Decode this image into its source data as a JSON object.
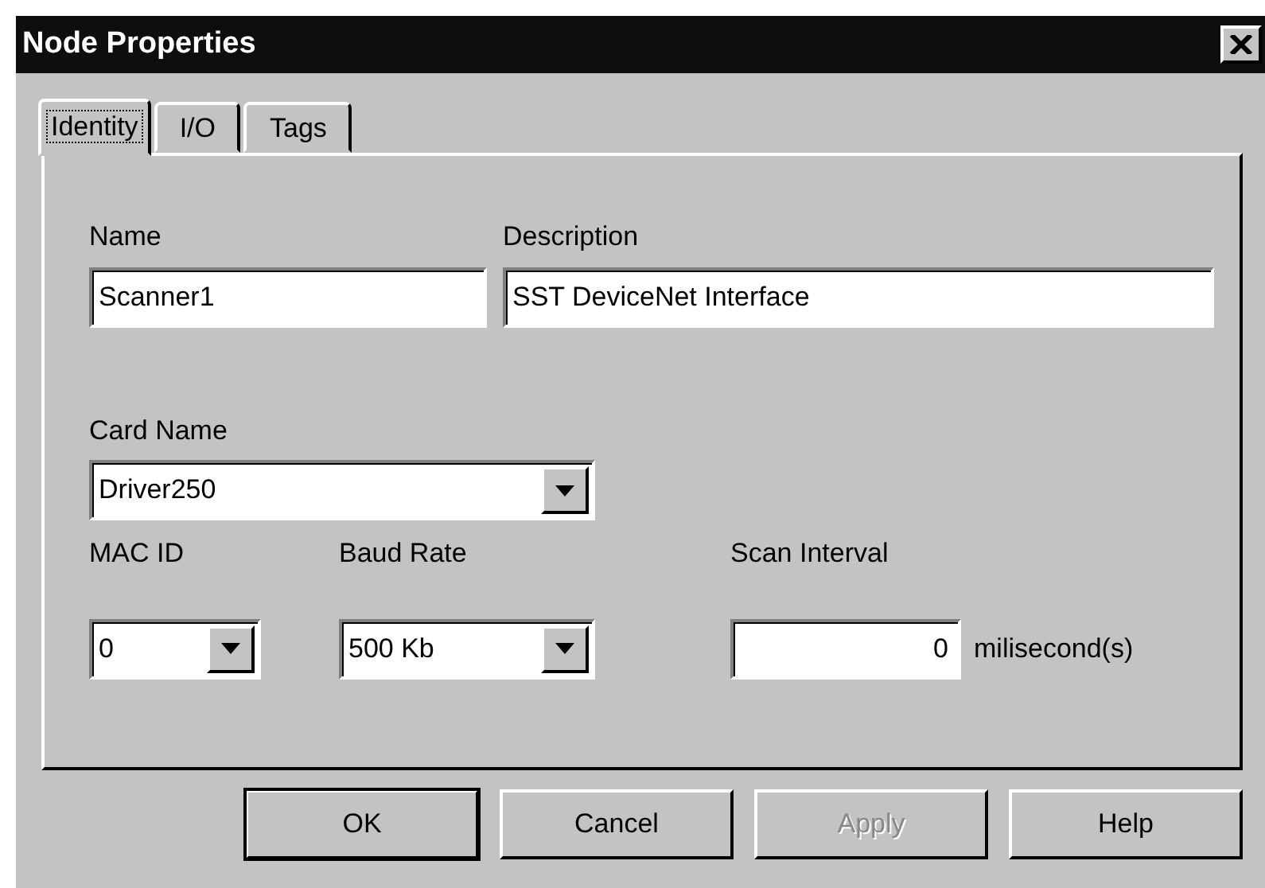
{
  "window": {
    "title": "Node Properties"
  },
  "tabs": [
    {
      "label": "Identity",
      "selected": true
    },
    {
      "label": "I/O",
      "selected": false
    },
    {
      "label": "Tags",
      "selected": false
    }
  ],
  "rows": [
    [
      {
        "kind": "text",
        "label": "Name",
        "value": "Scanner1"
      },
      {
        "kind": "text",
        "label": "Description",
        "value": "SST DeviceNet Interface"
      }
    ],
    [
      {
        "kind": "combo",
        "label": "Card Name",
        "value": "Driver250"
      }
    ],
    [
      {
        "kind": "combo",
        "label": "MAC ID",
        "value": "0"
      },
      {
        "kind": "combo",
        "label": "Baud Rate",
        "value": "500 Kb"
      },
      {
        "kind": "number",
        "label": "Scan Interval",
        "value": "0",
        "unit": "milisecond(s)"
      }
    ]
  ],
  "buttons": [
    {
      "label": "OK",
      "default": true,
      "disabled": false
    },
    {
      "label": "Cancel",
      "default": false,
      "disabled": false
    },
    {
      "label": "Apply",
      "default": false,
      "disabled": true
    },
    {
      "label": "Help",
      "default": false,
      "disabled": false
    }
  ]
}
